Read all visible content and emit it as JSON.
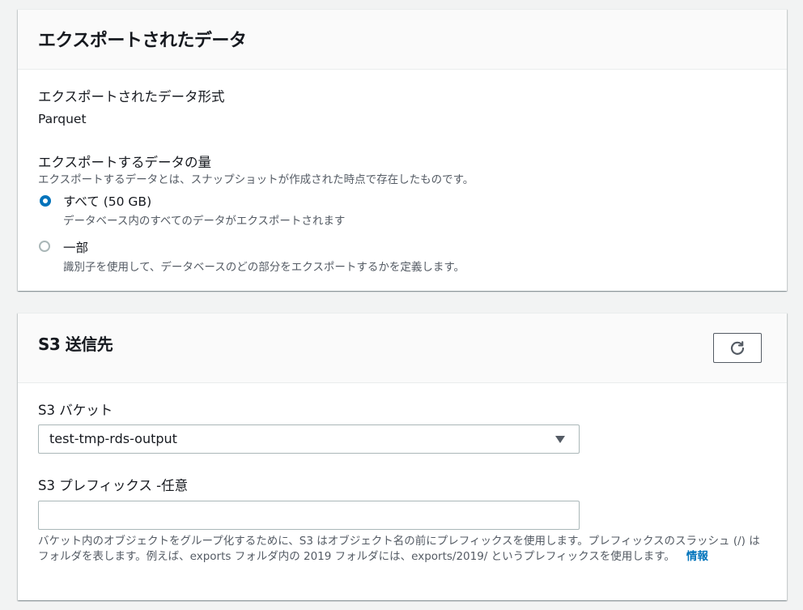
{
  "export_panel": {
    "title": "エクスポートされたデータ",
    "format_label": "エクスポートされたデータ形式",
    "format_value": "Parquet",
    "amount_label": "エクスポートするデータの量",
    "amount_description": "エクスポートするデータとは、スナップショットが作成された時点で存在したものです。",
    "options": [
      {
        "label": "すべて (50 GB)",
        "description": "データベース内のすべてのデータがエクスポートされます",
        "selected": true
      },
      {
        "label": "一部",
        "description": "識別子を使用して、データベースのどの部分をエクスポートするかを定義します。",
        "selected": false
      }
    ]
  },
  "s3_panel": {
    "title": "S3 送信先",
    "refresh_icon": "refresh-icon",
    "bucket_label": "S3 バケット",
    "bucket_value": "test-tmp-rds-output",
    "prefix_label": "S3 プレフィックス -任意",
    "prefix_value": "",
    "prefix_placeholder": "",
    "help_text": "バケット内のオブジェクトをグループ化するために、S3 はオブジェクト名の前にプレフィックスを使用します。プレフィックスのスラッシュ (/) はフォルダを表します。例えば、exports フォルダ内の 2019 フォルダには、exports/2019/ というプレフィックスを使用します。",
    "info_link": "情報"
  },
  "colors": {
    "accent": "#0073bb",
    "page_bg": "#f2f3f3",
    "text": "#16191f",
    "muted": "#545b64"
  }
}
